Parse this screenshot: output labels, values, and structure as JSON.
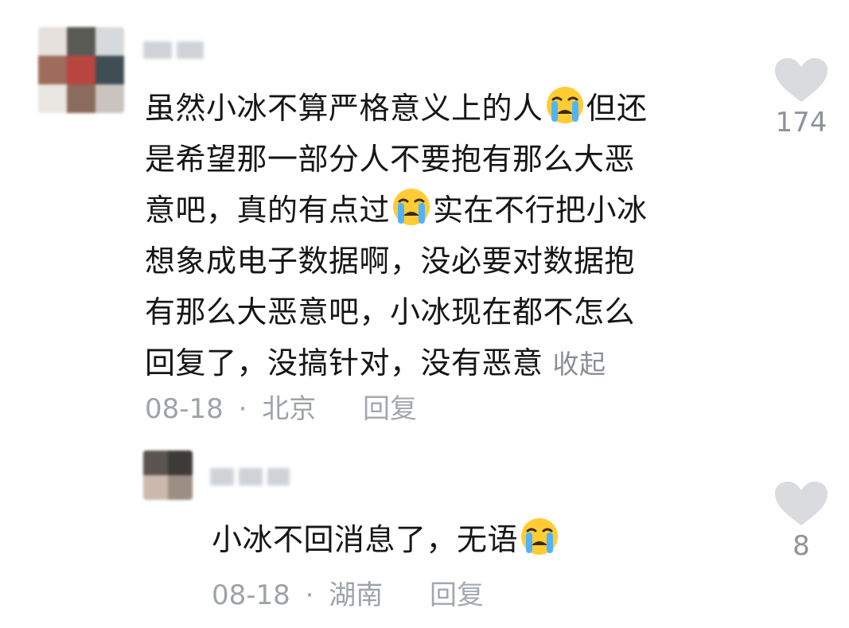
{
  "comment": {
    "lines": [
      "虽然小冰不算严格意义上的人",
      "但还",
      "是希望那一部分人不要抱有那么大恶",
      "意吧，真的有点过",
      "实在不行把小冰",
      "想象成电子数据啊，没必要对数据抱",
      "有那么大恶意吧，小冰现在都不怎么",
      "回复了，没搞针对，没有恶意"
    ],
    "collapse_label": "收起",
    "date": "08-18",
    "separator": "·",
    "location": "北京",
    "reply_label": "回复",
    "likes": "174",
    "emoji_icon": "loudly-crying-face"
  },
  "reply": {
    "text": "小冰不回消息了，无语",
    "date": "08-18",
    "separator": "·",
    "location": "湖南",
    "reply_label": "回复",
    "likes": "8",
    "emoji_icon": "loudly-crying-face"
  },
  "colors": {
    "text": "#161616",
    "meta": "#9ea3a9",
    "like_icon": "#d9dbde"
  }
}
